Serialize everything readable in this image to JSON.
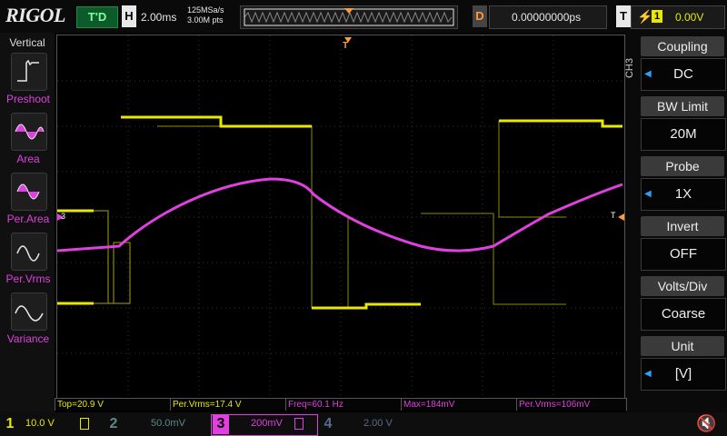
{
  "brand": {
    "logo_main": "RIGOL",
    "status": "T'D"
  },
  "topbar": {
    "horizontal_letter": "H",
    "timebase": "2.00ms",
    "sample_rate": "125MSa/s",
    "mem_depth": "3.00M pts",
    "delay_letter": "D",
    "delay_value": "0.00000000ps",
    "trigger_letter": "T",
    "trigger_source": "1",
    "trigger_level": "0.00V"
  },
  "left_panel": {
    "title": "Vertical",
    "items": [
      {
        "label": "Preshoot",
        "icon": "preshoot-icon"
      },
      {
        "label": "Area",
        "icon": "area-icon"
      },
      {
        "label": "Per.Area",
        "icon": "per-area-icon"
      },
      {
        "label": "Per.Vrms",
        "icon": "per-vrms-icon"
      },
      {
        "label": "Variance",
        "icon": "variance-icon"
      }
    ]
  },
  "right_panel": {
    "channel_tag": "CH3",
    "items": [
      {
        "header": "Coupling",
        "value": "DC",
        "has_arrow": true
      },
      {
        "header": "BW Limit",
        "value": "20M",
        "has_arrow": false
      },
      {
        "header": "Probe",
        "value": "1X",
        "has_arrow": true
      },
      {
        "header": "Invert",
        "value": "OFF",
        "has_arrow": false
      },
      {
        "header": "Volts/Div",
        "value": "Coarse",
        "has_arrow": false
      },
      {
        "header": "Unit",
        "value": "[V]",
        "has_arrow": true
      }
    ]
  },
  "measurements": [
    {
      "text": "Top=20.9 V",
      "color": "#e8e800"
    },
    {
      "text": "Per.Vrms=17.4 V",
      "color": "#e8e800"
    },
    {
      "text": "Freq=60.1 Hz",
      "color": "#e040e0"
    },
    {
      "text": "Max=184mV",
      "color": "#e040e0"
    },
    {
      "text": "Per.Vrms=106mV",
      "color": "#e040e0"
    }
  ],
  "channels": [
    {
      "num": "1",
      "scale": "10.0 V",
      "color": "#e8e800"
    },
    {
      "num": "2",
      "scale": "50.0mV",
      "color": "#5a8a8a"
    },
    {
      "num": "3",
      "scale": "200mV",
      "color": "#e040e0"
    },
    {
      "num": "4",
      "scale": "2.00 V",
      "color": "#5a6a8a"
    }
  ],
  "markers": {
    "trigger_pos": "T",
    "ch3_ref": "3",
    "ch1_trig_level": "T"
  },
  "colors": {
    "ch1": "#e8e800",
    "ch3": "#e040e0",
    "accent": "#ff9a3a"
  }
}
